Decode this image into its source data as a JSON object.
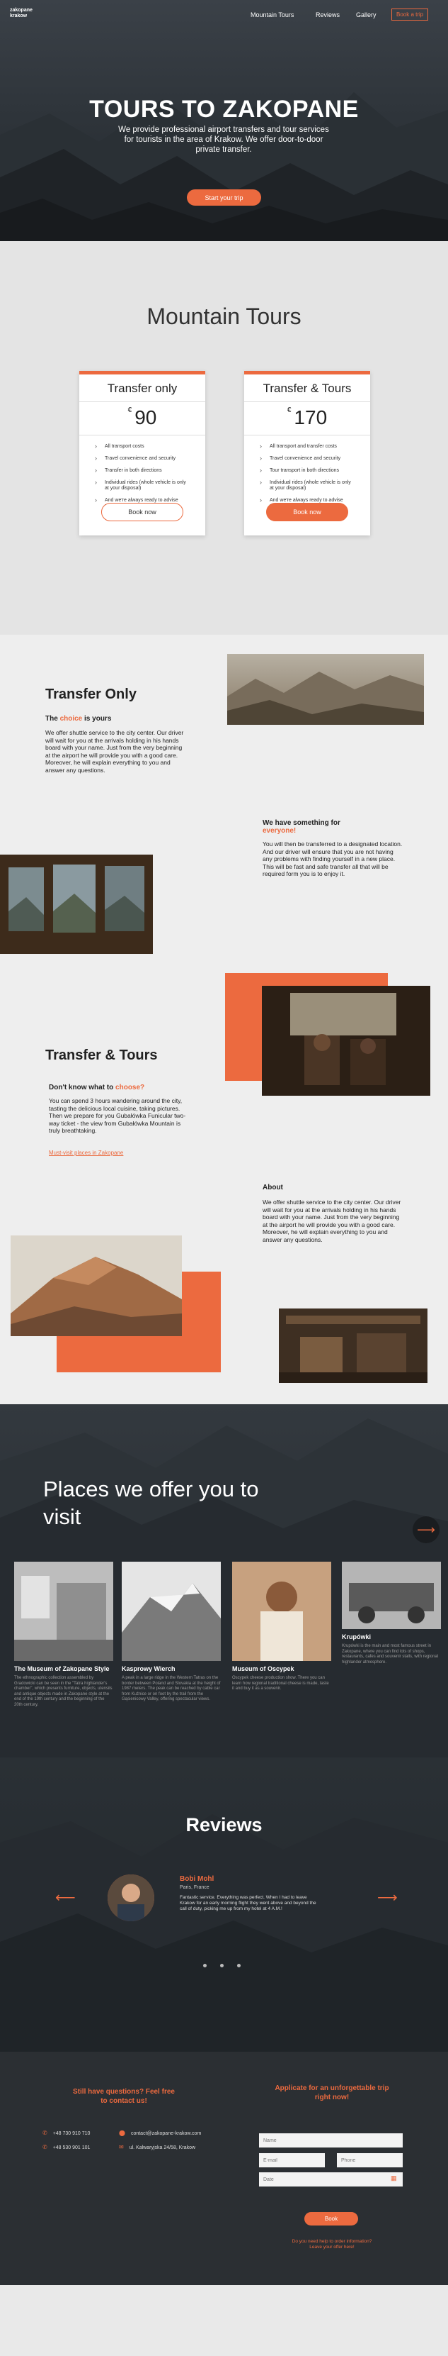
{
  "nav": {
    "logo_line1": "zakopane",
    "logo_line2": "krakow",
    "links": [
      "Mountain Tours",
      "Reviews",
      "Gallery"
    ],
    "book_label": "Book a trip"
  },
  "hero": {
    "title": "TOURS TO ZAKOPANE",
    "subtitle": "We  provide professional airport transfers and tour services for tourists in the area of Krakow. We offer door-to-door private transfer.",
    "button": "Start your trip"
  },
  "tours": {
    "title": "Mountain Tours",
    "cards": [
      {
        "title": "Transfer only",
        "currency": "€",
        "price": "90",
        "features": [
          "All transport costs",
          "Travel convenience and security",
          "Transfer in both directions",
          "Individual rides (whole vehicle is only at your disposal)",
          "And we're always ready to advise you in any matter"
        ],
        "button": "Book now"
      },
      {
        "title": "Transfer & Tours",
        "currency": "€",
        "price": "170",
        "features": [
          "All transport and transfer costs",
          "Travel convenience and security",
          "Tour transport in both directions",
          "Individual rides (whole vehicle is only at your disposal)",
          "And we're always ready to advise you in any matter"
        ],
        "button": "Book now"
      }
    ]
  },
  "content": {
    "transfer_title": "Transfer Only",
    "choice_pre": "The ",
    "choice_word": "choice",
    "choice_post": " is yours",
    "choice_text": "We offer shuttle service to the city center. Our driver will wait for you at the arrivals holding in his hands board with your name. Just from the very beginning at the airport he will provide you with a good care. Moreover, he will explain everything to you and answer any questions.",
    "something_title": "We have something for",
    "something_word": "everyone!",
    "something_text": "You will then be transferred to a designated location. And our driver will ensure that you are not having any problems with finding yourself in a new place. This will be fast and safe transfer all that will be required form you is to enjoy it.",
    "tours_title": "Transfer & Tours",
    "know_pre": "Don't know what to ",
    "know_word": "choose?",
    "know_text": "You can spend 3 hours wandering around the city, tasting the delicious local cuisine, taking pictures. Then we prepare for you Gubałówka Funicular two-way ticket - the view from Gubałówka Mountain is truly breathtaking.",
    "link": "Must-visit places in Zakopane",
    "about_title": "About",
    "about_text": "We offer shuttle service to the city center. Our driver will wait for you at the arrivals holding in his hands board with your name. Just from the very beginning at the airport he will provide you with a good care. Moreover, he will explain everything to you and answer any questions."
  },
  "places": {
    "title": "Places we offer you to visit",
    "items": [
      {
        "title": "The Museum of Zakopane Style",
        "text": "The ethnographic collection assembled by Gradowicki can be seen in the \"Tatra highlander's chamber\", which presents furniture, objects, utensils and antique objects made in Zakopane style at the end of the 19th century and the beginning of the 20th century."
      },
      {
        "title": "Kasprowy Wierch",
        "text": "A peak in a large ridge in the Western Tatras on the border between Poland and Slovakia at the height of 1987 meters. The peak can be reached by cable car from Kuźnice or on foot by the trail from the Gąsienicowy Valley, offering spectacular views."
      },
      {
        "title": "Museum of Oscypek",
        "text": "Oscypek cheese production show. There you can learn how regional traditional cheese is made, taste it and buy it as a souvenir."
      },
      {
        "title": "Krupówki",
        "text": "Krupówki is the main and most famous street in Zakopane, where you can find lots of shops, restaurants, cafes and souvenir stalls, with regional highlander atmosphere."
      }
    ]
  },
  "reviews": {
    "title": "Reviews",
    "name": "Bobi Mohl",
    "location": "Paris, France",
    "text": "Fantastic service. Everything was perfect. When I had to leave Krakow for an early morning flight they went above and beyond the call of duty, picking me up from my hotel at 4 A.M.!"
  },
  "footer": {
    "contact_title": "Still have questions? Feel free to contact us!",
    "phone1": "+48 730 910 710",
    "phone2": "+48 530 901 101",
    "email": "contact@zakopane-krakow.com",
    "address": "ul. Kalwaryjska 24/58, Krakow",
    "apply_title": "Applicate for an unforgettable trip right now!",
    "ph_name": "Name",
    "ph_email": "E-mail",
    "ph_phone": "Phone",
    "ph_date": "Date",
    "button": "Book",
    "note1": "Do you need help to order information?",
    "note2": "Leave your offer here!"
  },
  "colors": {
    "accent": "#ec6a3f",
    "dark": "#2b2f33"
  }
}
